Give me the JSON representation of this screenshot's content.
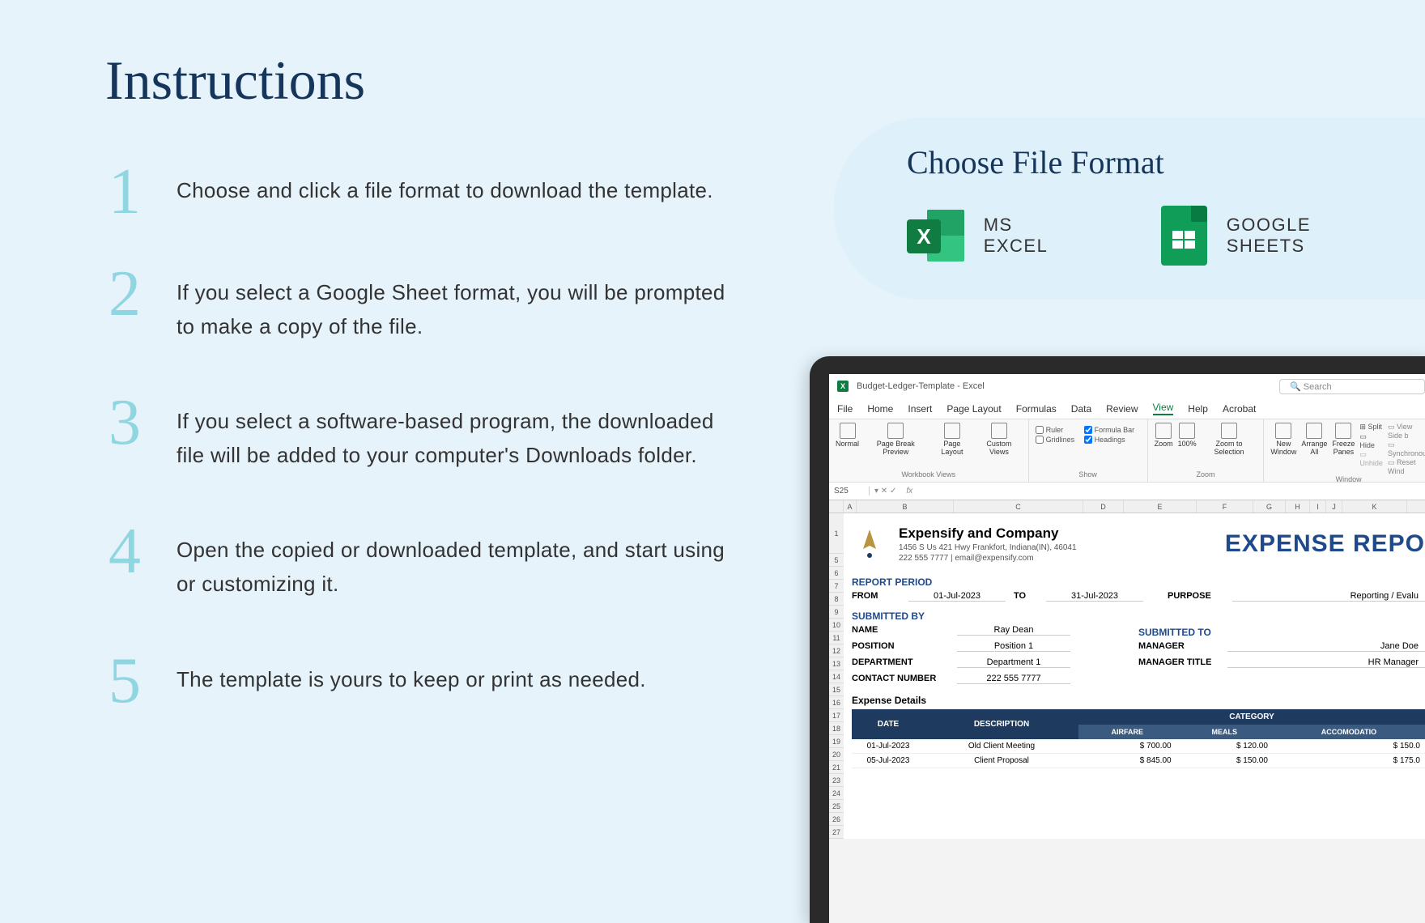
{
  "title": "Instructions",
  "steps": [
    {
      "num": "1",
      "text": "Choose and click a file format to download the template."
    },
    {
      "num": "2",
      "text": "If you select a Google Sheet format, you will be prompted to make a copy of the file."
    },
    {
      "num": "3",
      "text": "If you select a software-based program, the downloaded file will be added to your computer's Downloads folder."
    },
    {
      "num": "4",
      "text": "Open the copied or downloaded template, and start using or customizing it."
    },
    {
      "num": "5",
      "text": "The template is yours to keep or print as needed."
    }
  ],
  "format": {
    "title": "Choose File Format",
    "option1": "MS EXCEL",
    "option2": "GOOGLE SHEETS"
  },
  "excel": {
    "filename": "Budget-Ledger-Template  -  Excel",
    "search_placeholder": "Search",
    "tabs": [
      "File",
      "Home",
      "Insert",
      "Page Layout",
      "Formulas",
      "Data",
      "Review",
      "View",
      "Help",
      "Acrobat"
    ],
    "active_tab": "View",
    "ribbon_groups": {
      "workbook_views": {
        "label": "Workbook Views",
        "normal": "Normal",
        "pagebreak": "Page Break\nPreview",
        "pagelayout": "Page\nLayout",
        "custom": "Custom\nViews"
      },
      "show": {
        "label": "Show",
        "ruler": "Ruler",
        "formulabar": "Formula Bar",
        "gridlines": "Gridlines",
        "headings": "Headings"
      },
      "zoom": {
        "label": "Zoom",
        "zoom": "Zoom",
        "hundred": "100%",
        "selection": "Zoom to\nSelection"
      },
      "window": {
        "label": "Window",
        "newwin": "New\nWindow",
        "arrange": "Arrange\nAll",
        "freeze": "Freeze\nPanes",
        "split": "Split",
        "hide": "Hide",
        "unhide": "Unhide",
        "viewside": "View Side b",
        "sync": "Synchronou",
        "reset": "Reset Wind"
      }
    },
    "cell_ref": "S25",
    "fx": "fx",
    "columns": [
      "A",
      "B",
      "C",
      "D",
      "E",
      "F",
      "G",
      "H",
      "I",
      "J",
      "K"
    ],
    "rows": [
      "1",
      "5",
      "6",
      "7",
      "8",
      "9",
      "10",
      "11",
      "12",
      "13",
      "14",
      "15",
      "16",
      "17",
      "18",
      "19",
      "20",
      "21",
      "23",
      "24",
      "25",
      "26",
      "27"
    ],
    "sheet": {
      "company_name": "Expensify and Company",
      "company_addr": "1456 S Us 421 Hwy Frankfort, Indiana(IN), 46041",
      "company_contact": "222 555 7777 | email@expensify.com",
      "big_title": "EXPENSE REPO",
      "report_period": "REPORT PERIOD",
      "from": "FROM",
      "from_val": "01-Jul-2023",
      "to": "TO",
      "to_val": "31-Jul-2023",
      "purpose": "PURPOSE",
      "purpose_val": "Reporting / Evalu",
      "submitted_by": "SUBMITTED BY",
      "name": "NAME",
      "name_val": "Ray Dean",
      "position": "POSITION",
      "position_val": "Position 1",
      "department": "DEPARTMENT",
      "department_val": "Department 1",
      "contact": "CONTACT NUMBER",
      "contact_val": "222 555 7777",
      "submitted_to": "SUBMITTED TO",
      "manager": "MANAGER",
      "manager_val": "Jane Doe",
      "manager_title": "MANAGER TITLE",
      "manager_title_val": "HR Manager",
      "expense_details": "Expense Details",
      "th_date": "DATE",
      "th_desc": "DESCRIPTION",
      "th_cat": "CATEGORY",
      "th_airfare": "AIRFARE",
      "th_meals": "MEALS",
      "th_accom": "ACCOMODATIO",
      "rows_data": [
        {
          "date": "01-Jul-2023",
          "desc": "Old Client Meeting",
          "airfare": "700.00",
          "meals": "120.00",
          "accom": "150.0"
        },
        {
          "date": "05-Jul-2023",
          "desc": "Client Proposal",
          "airfare": "845.00",
          "meals": "150.00",
          "accom": "175.0"
        }
      ]
    }
  }
}
